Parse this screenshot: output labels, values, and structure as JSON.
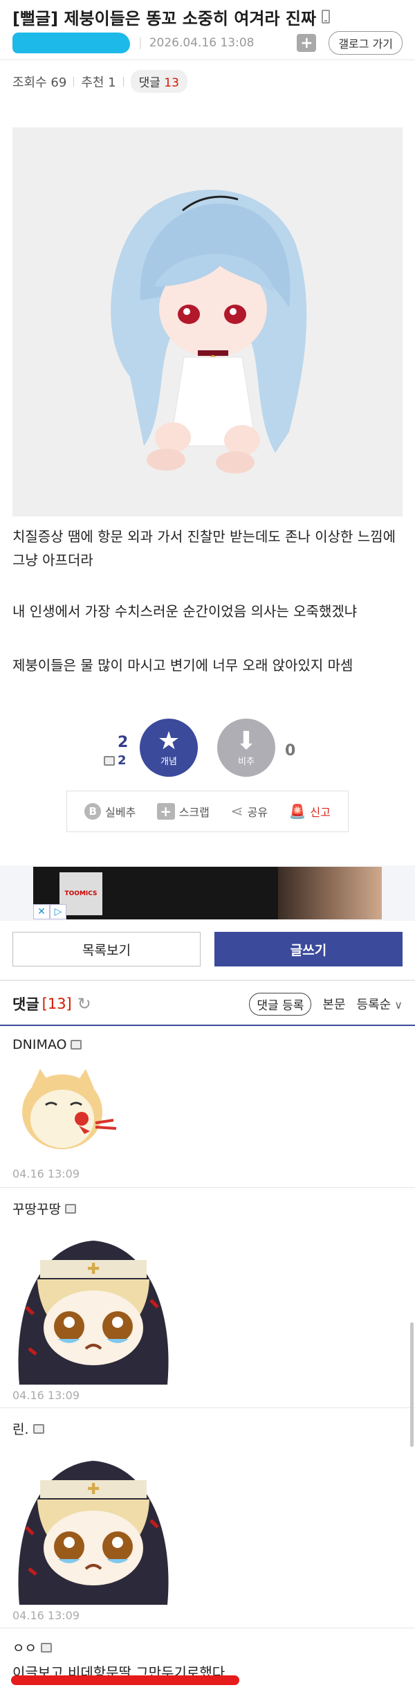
{
  "header": {
    "title": "[뻘글] 제붕이들은 똥꼬 소중히 여겨라 진짜",
    "date": "2026.04.16 13:08",
    "gallery_button": "갤로그 가기",
    "gallery_plus": "+"
  },
  "stats": {
    "views": "조회수 69",
    "recommends": "추천 1",
    "comments_label": "댓글",
    "comments_count": "13"
  },
  "body": {
    "paragraphs": [
      "치질증상 땜에 항문 외과 가서 진찰만 받는데도 존나 이상한 느낌에 그냥 아프더라",
      "내 인생에서 가장 수치스러운 순간이었음 의사는 오죽했겠냐",
      "제붕이들은 물 많이 마시고 변기에 너무 오래 앉아있지 마셈"
    ]
  },
  "reactions": {
    "up_count": "2",
    "up_fixed_count": "2",
    "up_label": "개념",
    "up_glyph": "★",
    "down_label": "비추",
    "down_glyph": "⬇",
    "down_count": "0"
  },
  "actions": {
    "b_glyph": "B",
    "report_not_rec": "실베추",
    "scrap": "스크랩",
    "share": "공유",
    "report": "신고",
    "share_glyph": "⋖",
    "siren_glyph": "🚨"
  },
  "ad": {
    "logo": "TOOMICS"
  },
  "buttons": {
    "list": "목록보기",
    "write": "글쓰기"
  },
  "comments_header": {
    "title": "댓글",
    "count": "[13]",
    "refresh_glyph": "↻",
    "register": "댓글 등록",
    "body_option": "본문",
    "sort_option": "등록순"
  },
  "comments": [
    {
      "nick": "DNIMAO",
      "date": "04.16 13:09"
    },
    {
      "nick": "꾸땅꾸땅",
      "date": "04.16 13:09"
    },
    {
      "nick": "린.",
      "date": "04.16 13:09"
    },
    {
      "nick": "ㅇㅇ",
      "text": "이글보고 비데항문딸 그만두기로했다"
    }
  ]
}
